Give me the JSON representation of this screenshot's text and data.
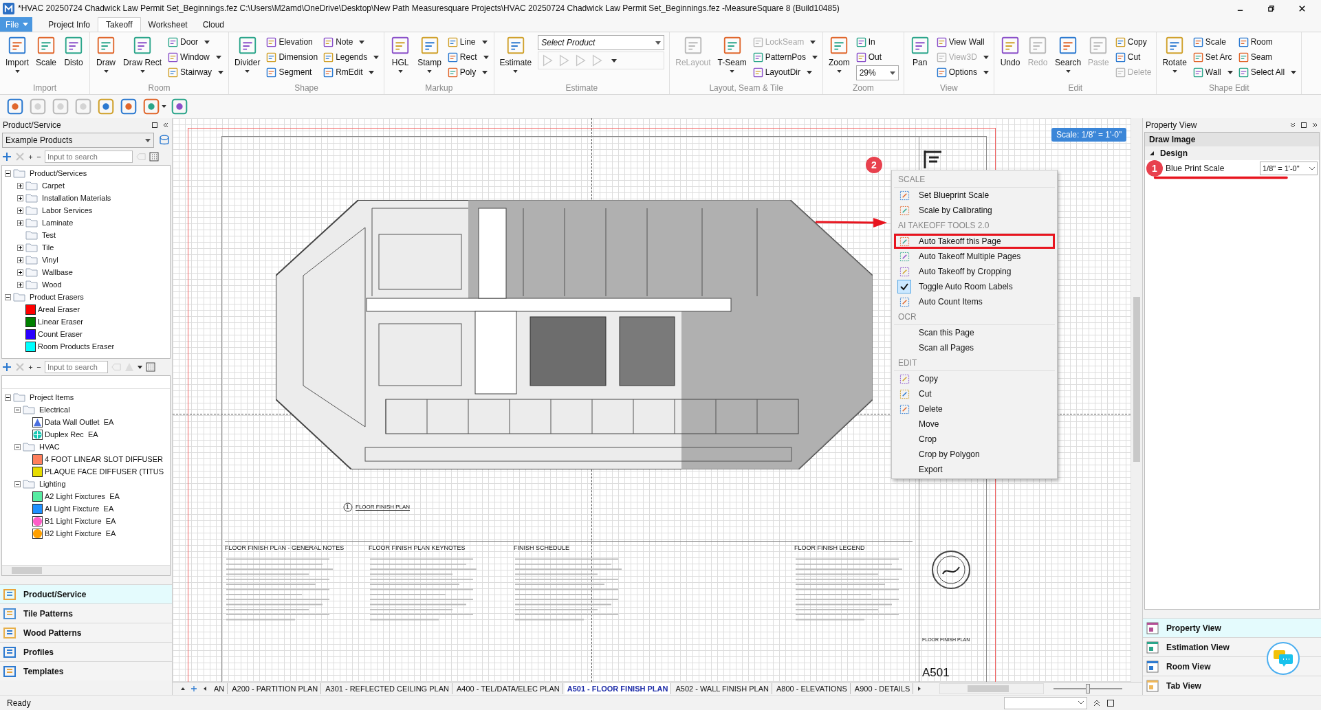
{
  "window": {
    "title": "*HVAC 20250724 Chadwick Law Permit Set_Beginnings.fez C:\\Users\\M2amd\\OneDrive\\Desktop\\New Path Measuresquare Projects\\HVAC 20250724 Chadwick Law Permit Set_Beginnings.fez -MeasureSquare 8 (Build10485)"
  },
  "ribbon_tabs": [
    {
      "label": "File",
      "kind": "file",
      "selected": false
    },
    {
      "label": "Project Info",
      "kind": "tab",
      "selected": false
    },
    {
      "label": "Takeoff",
      "kind": "tab",
      "selected": true
    },
    {
      "label": "Worksheet",
      "kind": "tab",
      "selected": false
    },
    {
      "label": "Cloud",
      "kind": "tab",
      "selected": false
    }
  ],
  "ribbon_groups": [
    {
      "label": "Import",
      "items": [
        {
          "kind": "large",
          "label": "Import",
          "dropdown": true,
          "disabled": false
        },
        {
          "kind": "large",
          "label": "Scale",
          "dropdown": false,
          "disabled": false
        },
        {
          "kind": "large",
          "label": "Disto",
          "dropdown": false,
          "disabled": false
        }
      ]
    },
    {
      "label": "Room",
      "items": [
        {
          "kind": "large",
          "label": "Draw",
          "dropdown": true,
          "disabled": false
        },
        {
          "kind": "large",
          "label": "Draw Rect",
          "dropdown": true,
          "disabled": false
        },
        {
          "kind": "stack",
          "tools": [
            {
              "kind": "button",
              "label": "Door",
              "dropdown": true,
              "disabled": false
            },
            {
              "kind": "button",
              "label": "Window",
              "dropdown": true,
              "disabled": false
            },
            {
              "kind": "button",
              "label": "Stairway",
              "dropdown": true,
              "disabled": false
            }
          ]
        }
      ]
    },
    {
      "label": "Shape",
      "items": [
        {
          "kind": "large",
          "label": "Divider",
          "dropdown": true,
          "disabled": false
        },
        {
          "kind": "stack",
          "tools": [
            {
              "kind": "button",
              "label": "Elevation",
              "dropdown": false,
              "disabled": false
            },
            {
              "kind": "button",
              "label": "Dimension",
              "dropdown": false,
              "disabled": false
            },
            {
              "kind": "button",
              "label": "Segment",
              "dropdown": false,
              "disabled": false
            }
          ]
        },
        {
          "kind": "stack",
          "tools": [
            {
              "kind": "button",
              "label": "Note",
              "dropdown": true,
              "disabled": false
            },
            {
              "kind": "button",
              "label": "Legends",
              "dropdown": true,
              "disabled": false
            },
            {
              "kind": "button",
              "label": "RmEdit",
              "dropdown": true,
              "disabled": false
            }
          ]
        }
      ]
    },
    {
      "label": "Markup",
      "items": [
        {
          "kind": "large",
          "label": "HGL",
          "dropdown": true,
          "disabled": false
        },
        {
          "kind": "large",
          "label": "Stamp",
          "dropdown": true,
          "disabled": false
        },
        {
          "kind": "stack",
          "tools": [
            {
              "kind": "button",
              "label": "Line",
              "dropdown": true,
              "disabled": false
            },
            {
              "kind": "button",
              "label": "Rect",
              "dropdown": true,
              "disabled": false
            },
            {
              "kind": "button",
              "label": "Poly",
              "dropdown": true,
              "disabled": false
            }
          ]
        }
      ]
    },
    {
      "label": "Estimate",
      "items": [
        {
          "kind": "large",
          "label": "Estimate",
          "dropdown": true,
          "disabled": false
        },
        {
          "kind": "stack",
          "tools": [
            {
              "kind": "select",
              "value": "Select Product"
            },
            {
              "kind": "icon_row",
              "dropdown": true,
              "icons": [
                {
                  "disabled": true
                },
                {
                  "disabled": true
                },
                {
                  "disabled": true
                },
                {
                  "disabled": true
                }
              ]
            }
          ]
        }
      ]
    },
    {
      "label": "Layout, Seam & Tile",
      "items": [
        {
          "kind": "large",
          "label": "ReLayout",
          "dropdown": false,
          "disabled": true
        },
        {
          "kind": "large",
          "label": "T-Seam",
          "dropdown": true,
          "disabled": false
        },
        {
          "kind": "stack",
          "tools": [
            {
              "kind": "button",
              "label": "LockSeam",
              "dropdown": true,
              "disabled": true
            },
            {
              "kind": "button",
              "label": "PatternPos",
              "dropdown": true,
              "disabled": false
            },
            {
              "kind": "button",
              "label": "LayoutDir",
              "dropdown": true,
              "disabled": false
            }
          ]
        }
      ]
    },
    {
      "label": "Zoom",
      "items": [
        {
          "kind": "large",
          "label": "Zoom",
          "dropdown": true,
          "disabled": false
        },
        {
          "kind": "stack",
          "tools": [
            {
              "kind": "button",
              "label": "In",
              "dropdown": false,
              "disabled": false
            },
            {
              "kind": "button",
              "label": "Out",
              "dropdown": false,
              "disabled": false
            },
            {
              "kind": "select",
              "value": "29%"
            }
          ]
        }
      ]
    },
    {
      "label": "View",
      "items": [
        {
          "kind": "large",
          "label": "Pan",
          "dropdown": false,
          "disabled": false
        },
        {
          "kind": "stack",
          "tools": [
            {
              "kind": "button",
              "label": "View Wall",
              "dropdown": false,
              "disabled": false
            },
            {
              "kind": "button",
              "label": "View3D",
              "dropdown": true,
              "disabled": true
            },
            {
              "kind": "button",
              "label": "Options",
              "dropdown": true,
              "disabled": false
            }
          ]
        }
      ]
    },
    {
      "label": "Edit",
      "items": [
        {
          "kind": "large",
          "label": "Undo",
          "dropdown": false,
          "disabled": false
        },
        {
          "kind": "large",
          "label": "Redo",
          "dropdown": false,
          "disabled": true
        },
        {
          "kind": "large",
          "label": "Search",
          "dropdown": true,
          "disabled": false
        },
        {
          "kind": "large",
          "label": "Paste",
          "dropdown": false,
          "disabled": true
        },
        {
          "kind": "stack",
          "tools": [
            {
              "kind": "button",
              "label": "Copy",
              "dropdown": false,
              "disabled": false
            },
            {
              "kind": "button",
              "label": "Cut",
              "dropdown": false,
              "disabled": false
            },
            {
              "kind": "button",
              "label": "Delete",
              "dropdown": false,
              "disabled": true
            }
          ]
        }
      ]
    },
    {
      "label": "Shape Edit",
      "items": [
        {
          "kind": "large",
          "label": "Rotate",
          "dropdown": true,
          "disabled": false
        },
        {
          "kind": "stack",
          "tools": [
            {
              "kind": "button",
              "label": "Scale",
              "dropdown": false,
              "disabled": false
            },
            {
              "kind": "button",
              "label": "Set Arc",
              "dropdown": false,
              "disabled": false
            },
            {
              "kind": "button",
              "label": "Wall",
              "dropdown": true,
              "disabled": false
            }
          ]
        },
        {
          "kind": "stack",
          "tools": [
            {
              "kind": "button",
              "label": "Room",
              "dropdown": false,
              "disabled": false
            },
            {
              "kind": "button",
              "label": "Seam",
              "dropdown": false,
              "disabled": false
            },
            {
              "kind": "button",
              "label": "Select All",
              "dropdown": true,
              "disabled": false
            }
          ]
        }
      ]
    }
  ],
  "quick_tools": [
    {
      "disabled": false,
      "dropdown": false
    },
    {
      "disabled": true,
      "dropdown": false
    },
    {
      "disabled": true,
      "dropdown": false
    },
    {
      "disabled": true,
      "dropdown": false
    },
    {
      "disabled": false,
      "dropdown": false
    },
    {
      "disabled": false,
      "dropdown": false
    },
    {
      "disabled": false,
      "dropdown": true
    },
    {
      "disabled": false,
      "dropdown": false
    }
  ],
  "product_panel": {
    "title": "Product/Service",
    "catalog": "Example Products",
    "search_placeholder": "Input to search",
    "tree": [
      {
        "label": "Product/Services",
        "kind": "folder",
        "expanded": true,
        "children": [
          {
            "label": "Carpet",
            "kind": "folder",
            "expanded": false
          },
          {
            "label": "Installation Materials",
            "kind": "folder",
            "expanded": false
          },
          {
            "label": "Labor Services",
            "kind": "folder",
            "expanded": false
          },
          {
            "label": "Laminate",
            "kind": "folder",
            "expanded": false
          },
          {
            "label": "Test",
            "kind": "folder"
          },
          {
            "label": "Tile",
            "kind": "folder",
            "expanded": false
          },
          {
            "label": "Vinyl",
            "kind": "folder",
            "expanded": false
          },
          {
            "label": "Wallbase",
            "kind": "folder",
            "expanded": false
          },
          {
            "label": "Wood",
            "kind": "folder",
            "expanded": false
          }
        ]
      },
      {
        "label": "Product Erasers",
        "kind": "folder",
        "expanded": true,
        "children": [
          {
            "label": "Areal Eraser",
            "kind": "swatch",
            "color": "#ff0000"
          },
          {
            "label": "Linear Eraser",
            "kind": "swatch",
            "color": "#008000"
          },
          {
            "label": "Count Eraser",
            "kind": "swatch",
            "color": "#2a00ff"
          },
          {
            "label": "Room Products Eraser",
            "kind": "swatch",
            "color": "#00ffff"
          }
        ]
      }
    ]
  },
  "project_panel": {
    "search_placeholder": "Input to search",
    "tree": [
      {
        "label": "Project Items",
        "kind": "folder",
        "expanded": true,
        "children": [
          {
            "label": "Electrical",
            "kind": "folder",
            "expanded": true,
            "children": [
              {
                "label": "Data Wall Outlet  EA",
                "kind": "triangle",
                "color": "#4a6fe0"
              },
              {
                "label": "Duplex Rec  EA",
                "kind": "globe",
                "color": "#19c8b4"
              }
            ]
          },
          {
            "label": "HVAC",
            "kind": "folder",
            "expanded": true,
            "children": [
              {
                "label": "4 FOOT LINEAR SLOT DIFFUSER",
                "kind": "swatch",
                "color": "#ff7f5c"
              },
              {
                "label": "PLAQUE FACE DIFFUSER (TITUS",
                "kind": "swatch",
                "color": "#e6dc00"
              }
            ]
          },
          {
            "label": "Lighting",
            "kind": "folder",
            "expanded": true,
            "children": [
              {
                "label": "A2 Light Fixctures  EA",
                "kind": "swatch",
                "color": "#57eba2"
              },
              {
                "label": "AI Light Fixcture  EA",
                "kind": "swatch",
                "color": "#1e90ff"
              },
              {
                "label": "B1 Light Fixcture  EA",
                "kind": "dot",
                "color": "#ff5cc8"
              },
              {
                "label": "B2 Light Fixcture  EA",
                "kind": "dot",
                "color": "#ffa000"
              }
            ]
          }
        ]
      }
    ]
  },
  "left_nav": [
    {
      "label": "Product/Service",
      "selected": true
    },
    {
      "label": "Tile Patterns",
      "selected": false
    },
    {
      "label": "Wood Patterns",
      "selected": false
    },
    {
      "label": "Profiles",
      "selected": false
    },
    {
      "label": "Templates",
      "selected": false
    }
  ],
  "drawing": {
    "scale_badge": "Scale: 1/8\" = 1'-0\"",
    "plan_number": "1",
    "plan_label": "FLOOR FINISH PLAN",
    "schedules": [
      "FLOOR FINISH PLAN - GENERAL NOTES",
      "FLOOR FINISH PLAN KEYNOTES",
      "FINISH SCHEDULE",
      "FLOOR FINISH LEGEND"
    ],
    "title_block_label": "FLOOR FINISH PLAN",
    "sheet_number": "A501"
  },
  "context_menu": {
    "callout": "2",
    "sections": [
      {
        "heading": "SCALE",
        "items": [
          {
            "label": "Set Blueprint Scale",
            "has_icon": true,
            "checked": false,
            "highlighted": false
          },
          {
            "label": "Scale by Calibrating",
            "has_icon": true,
            "checked": false,
            "highlighted": false
          }
        ]
      },
      {
        "heading": "AI TAKEOFF TOOLS 2.0",
        "items": [
          {
            "label": "Auto Takeoff this Page",
            "has_icon": true,
            "checked": false,
            "highlighted": true
          },
          {
            "label": "Auto Takeoff Multiple Pages",
            "has_icon": true,
            "checked": false,
            "highlighted": false
          },
          {
            "label": "Auto Takeoff by Cropping",
            "has_icon": true,
            "checked": false,
            "highlighted": false
          },
          {
            "label": "Toggle Auto Room Labels",
            "checked": true,
            "highlighted": false
          },
          {
            "label": "Auto Count Items",
            "has_icon": true,
            "checked": false,
            "highlighted": false
          }
        ]
      },
      {
        "heading": "OCR",
        "items": [
          {
            "label": "Scan this Page",
            "has_icon": false,
            "checked": false,
            "highlighted": false
          },
          {
            "label": "Scan all Pages",
            "has_icon": false,
            "checked": false,
            "highlighted": false
          }
        ]
      },
      {
        "heading": "EDIT",
        "items": [
          {
            "label": "Copy",
            "has_icon": true,
            "checked": false,
            "highlighted": false
          },
          {
            "label": "Cut",
            "has_icon": true,
            "checked": false,
            "highlighted": false
          },
          {
            "label": "Delete",
            "has_icon": true,
            "checked": false,
            "highlighted": false
          },
          {
            "label": "Move",
            "has_icon": false,
            "checked": false,
            "highlighted": false
          },
          {
            "label": "Crop",
            "has_icon": false,
            "checked": false,
            "highlighted": false
          },
          {
            "label": "Crop by Polygon",
            "has_icon": false,
            "checked": false,
            "highlighted": false
          },
          {
            "label": "Export",
            "has_icon": false,
            "checked": false,
            "highlighted": false
          }
        ]
      }
    ]
  },
  "page_tabs": [
    {
      "label": "AN",
      "selected": false
    },
    {
      "label": "A200 - PARTITION PLAN",
      "selected": false
    },
    {
      "label": "A301 - REFLECTED CEILING PLAN",
      "selected": false
    },
    {
      "label": "A400 - TEL/DATA/ELEC PLAN",
      "selected": false
    },
    {
      "label": "A501 - FLOOR FINISH PLAN",
      "selected": true
    },
    {
      "label": "A502 - WALL FINISH PLAN",
      "selected": false
    },
    {
      "label": "A800 - ELEVATIONS",
      "selected": false
    },
    {
      "label": "A900 - DETAILS",
      "selected": false
    }
  ],
  "zoom_slider": {
    "level": 0.5
  },
  "property_view": {
    "title": "Property View",
    "object": "Draw Image",
    "category": {
      "label": "Design",
      "expanded": true
    },
    "rows": [
      {
        "name": "Blue Print Scale",
        "value": "1/8\" = 1'-0\"",
        "callout": "1"
      }
    ]
  },
  "right_nav": [
    {
      "label": "Property View",
      "selected": true
    },
    {
      "label": "Estimation View",
      "selected": false
    },
    {
      "label": "Room View",
      "selected": false
    },
    {
      "label": "Tab View",
      "selected": false
    }
  ],
  "status_bar": {
    "text": "Ready"
  }
}
